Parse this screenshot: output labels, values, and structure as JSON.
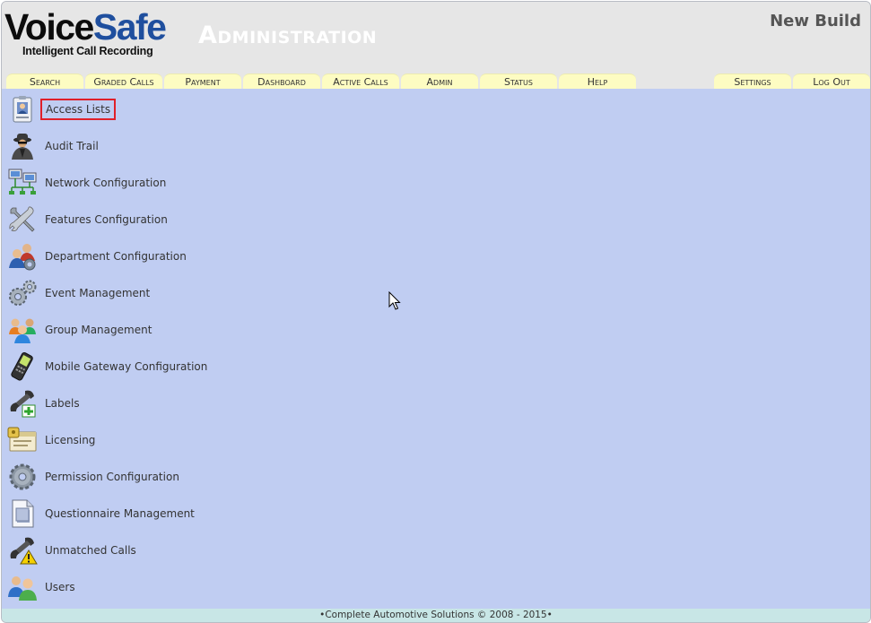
{
  "header": {
    "logo_voice": "Voice",
    "logo_safe": "Safe",
    "tagline": "Intelligent Call Recording",
    "section_title": "Administration",
    "build_label": "New Build"
  },
  "nav": {
    "tabs": [
      "Search",
      "Graded Calls",
      "Payment",
      "Dashboard",
      "Active Calls",
      "Admin",
      "Status",
      "Help"
    ],
    "right_tabs": [
      "Settings",
      "Log Out"
    ]
  },
  "admin_menu": {
    "items": [
      {
        "label": "Access Lists",
        "icon": "id-badge-icon",
        "selected": true
      },
      {
        "label": "Audit Trail",
        "icon": "spy-icon"
      },
      {
        "label": "Network Configuration",
        "icon": "network-computers-icon"
      },
      {
        "label": "Features Configuration",
        "icon": "tools-icon"
      },
      {
        "label": "Department Configuration",
        "icon": "people-gear-icon"
      },
      {
        "label": "Event Management",
        "icon": "gears-icon"
      },
      {
        "label": "Group Management",
        "icon": "group-people-icon"
      },
      {
        "label": "Mobile Gateway Configuration",
        "icon": "mobile-phone-icon"
      },
      {
        "label": "Labels",
        "icon": "phone-add-icon"
      },
      {
        "label": "Licensing",
        "icon": "license-certificate-icon"
      },
      {
        "label": "Permission Configuration",
        "icon": "gear-icon"
      },
      {
        "label": "Questionnaire Management",
        "icon": "document-icon"
      },
      {
        "label": "Unmatched Calls",
        "icon": "phone-warning-icon"
      },
      {
        "label": "Users",
        "icon": "users-icon"
      }
    ]
  },
  "footer": {
    "text": "•Complete Automotive Solutions © 2008 - 2015•"
  },
  "colors": {
    "content_bg": "#c0cdf2",
    "tab_bg": "#fdfcc2",
    "header_bg": "#e6e6e6",
    "footer_bg": "#c8e6e6",
    "brand_blue": "#1f4f9e",
    "selection_outline": "#e0202a"
  }
}
